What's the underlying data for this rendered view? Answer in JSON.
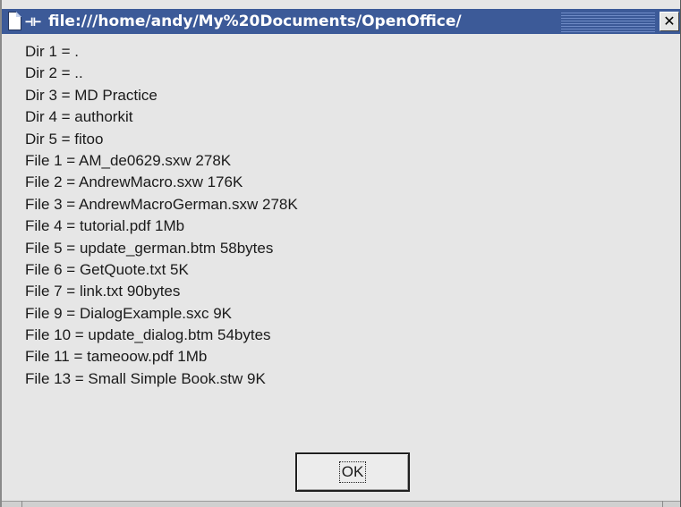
{
  "window": {
    "title": "file:///home/andy/My%20Documents/OpenOffice/",
    "close_label": "✕",
    "pin_glyph": "⊣⊢"
  },
  "lines": [
    "Dir 1 = .",
    "Dir 2 = ..",
    "Dir 3 = MD Practice",
    "Dir 4 = authorkit",
    "Dir 5 = fitoo",
    "File 1 = AM_de0629.sxw  278K",
    "File 2 = AndrewMacro.sxw  176K",
    "File 3 = AndrewMacroGerman.sxw  278K",
    "File 4 = tutorial.pdf  1Mb",
    "File 5 = update_german.btm  58bytes",
    "File 6 = GetQuote.txt  5K",
    "File 7 = link.txt  90bytes",
    "File 9 = DialogExample.sxc  9K",
    "File 10 = update_dialog.btm  54bytes",
    "File 11 = tameoow.pdf  1Mb",
    "File 13 = Small Simple Book.stw  9K"
  ],
  "ok_button": {
    "label": "OK"
  },
  "colors": {
    "titlebar": "#3c5a98",
    "window_bg": "#e6e6e6"
  }
}
